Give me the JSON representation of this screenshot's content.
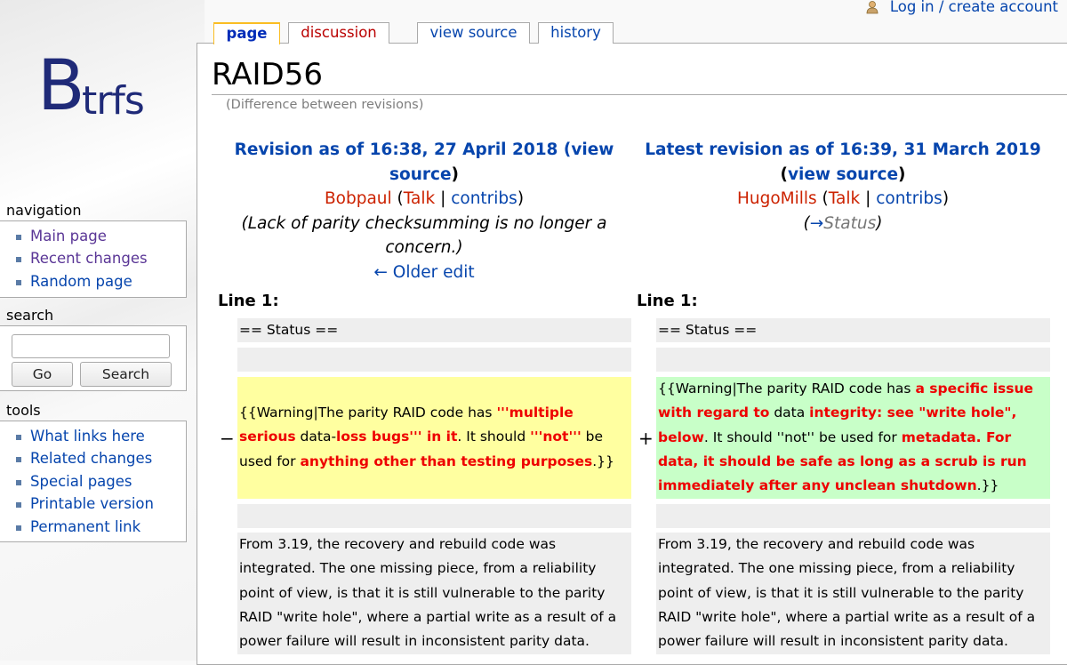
{
  "top": {
    "user_link": "Log in / create account"
  },
  "tabs": [
    {
      "label": "page"
    },
    {
      "label": "discussion"
    },
    {
      "label": "view source"
    },
    {
      "label": "history"
    }
  ],
  "logo": {
    "first": "B",
    "rest": "trfs"
  },
  "sidebar": {
    "navigation": {
      "title": "navigation",
      "items": [
        "Main page",
        "Recent changes",
        "Random page"
      ]
    },
    "search": {
      "title": "search",
      "go": "Go",
      "search": "Search",
      "value": ""
    },
    "tools": {
      "title": "tools",
      "items": [
        "What links here",
        "Related changes",
        "Special pages",
        "Printable version",
        "Permanent link"
      ]
    }
  },
  "page": {
    "title": "RAID56",
    "subtitle": "(Difference between revisions)"
  },
  "left": {
    "rev_prefix": "Revision as of 16:38, 27 April 2018 (",
    "view_source": "view source",
    "rev_suffix": ")",
    "user": "Bobpaul",
    "talk": "Talk",
    "contribs": "contribs",
    "summary": "(Lack of parity checksumming is no longer a concern.)",
    "older": "← Older edit",
    "line": "Line 1:"
  },
  "right": {
    "rev_prefix": "Latest revision as of 16:39, 31 March 2019",
    "view_source": "view source",
    "user": "HugoMills",
    "talk": "Talk",
    "contribs": "contribs",
    "summary_arrow": "→",
    "summary_text": "Status",
    "line": "Line 1:"
  },
  "diff": {
    "context_status": "== Status ==",
    "minus": "−",
    "plus": "+",
    "left_change": [
      {
        "t": "{{Warning|The parity RAID code has ",
        "h": false
      },
      {
        "t": "'''multiple serious",
        "h": true
      },
      {
        "t": " data-",
        "h": false
      },
      {
        "t": "loss bugs''' in it",
        "h": true
      },
      {
        "t": ". It should ",
        "h": false
      },
      {
        "t": "'''not'''",
        "h": true
      },
      {
        "t": " be used for ",
        "h": false
      },
      {
        "t": "anything other than testing purposes",
        "h": true
      },
      {
        "t": ".}}",
        "h": false
      }
    ],
    "right_change": [
      {
        "t": "{{Warning|The parity RAID code has ",
        "h": false
      },
      {
        "t": "a specific issue with regard to",
        "h": true
      },
      {
        "t": " data ",
        "h": false
      },
      {
        "t": "integrity: see \"write hole\", below",
        "h": true
      },
      {
        "t": ". It should ''not'' be used for ",
        "h": false
      },
      {
        "t": "metadata. For data, it should be safe as long as a scrub is run immediately after any unclean shutdown",
        "h": true
      },
      {
        "t": ".}}",
        "h": false
      }
    ],
    "context_para": "From 3.19, the recovery and rebuild code was integrated. The one missing piece, from a reliability point of view, is that it is still vulnerable to the parity RAID \"write hole\", where a partial write as a result of a power failure will result in inconsistent parity data."
  }
}
